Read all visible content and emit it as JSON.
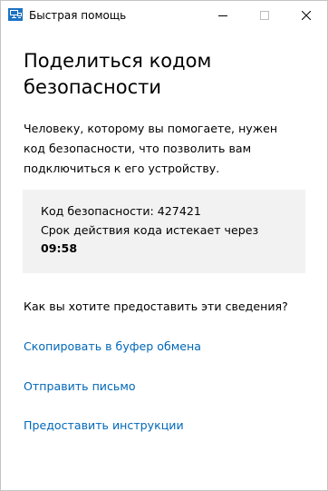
{
  "window": {
    "title": "Быстрая помощь"
  },
  "icons": {
    "app": "remote-assistance-icon",
    "minimize": "minimize-icon",
    "maximize": "maximize-icon",
    "close": "close-icon"
  },
  "main": {
    "heading": "Поделиться кодом безопасности",
    "description": "Человеку, которому вы помогаете, нужен код безопасности, что позволить вам подключиться к его устройству.",
    "code_line": "Код безопасности: 427421",
    "expiry_line": "Срок действия кода истекает через",
    "timer": "09:58",
    "question": "Как вы хотите предоставить эти сведения?",
    "links": {
      "copy": "Скопировать в буфер обмена",
      "email": "Отправить письмо",
      "instructions": "Предоставить инструкции"
    }
  },
  "colors": {
    "accent_link": "#0067b8",
    "code_box_bg": "#f2f2f2",
    "icon_blue": "#1e72c2"
  }
}
